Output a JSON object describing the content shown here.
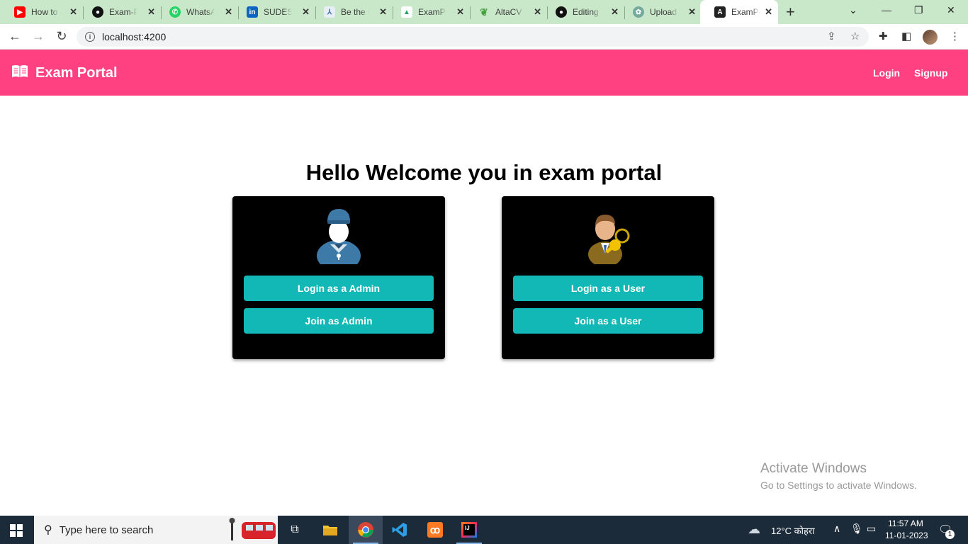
{
  "browser": {
    "tabs": [
      {
        "label": "How to c",
        "icon": "youtube-icon",
        "color": "#ff0000"
      },
      {
        "label": "Exam-Po",
        "icon": "github-icon",
        "color": "#111111"
      },
      {
        "label": "WhatsAp",
        "icon": "whatsapp-icon",
        "color": "#25d366"
      },
      {
        "label": "SUDESH",
        "icon": "linkedin-icon",
        "color": "#0a66c2"
      },
      {
        "label": "Be the N",
        "icon": "site-icon",
        "color": "#3a6ea5"
      },
      {
        "label": "ExamPor",
        "icon": "google-drive-icon",
        "color": "#1fa463"
      },
      {
        "label": "AltaCV |",
        "icon": "overleaf-icon",
        "color": "#47a141"
      },
      {
        "label": "Editing C",
        "icon": "github-icon",
        "color": "#111111"
      },
      {
        "label": "Upload |",
        "icon": "chatgpt-icon",
        "color": "#74aa9c"
      },
      {
        "label": "ExamPor",
        "icon": "angular-icon",
        "color": "#dd0031"
      }
    ],
    "address": "localhost:4200"
  },
  "app": {
    "brand": "Exam Portal",
    "nav": {
      "login": "Login",
      "signup": "Signup"
    },
    "heading": "Hello Welcome you in exam portal",
    "admin_card": {
      "login_label": "Login as a Admin",
      "join_label": "Join as Admin"
    },
    "user_card": {
      "login_label": "Login as a User",
      "join_label": "Join as a User"
    },
    "colors": {
      "navbar": "#ff4081",
      "button": "#12b8b6",
      "card": "#000000"
    }
  },
  "watermark": {
    "line1": "Activate Windows",
    "line2": "Go to Settings to activate Windows."
  },
  "taskbar": {
    "search_placeholder": "Type here to search",
    "weather": "12°C कोहरा",
    "time": "11:57 AM",
    "date": "11-01-2023",
    "notification_count": "1"
  }
}
